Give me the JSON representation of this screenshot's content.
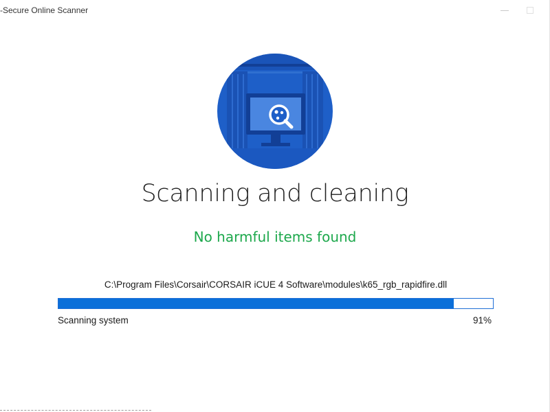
{
  "window": {
    "title": "-Secure Online Scanner"
  },
  "hero": {
    "icon": "scan-monitor-icon",
    "colors": {
      "circle": "#1e5fc8",
      "dark": "#123f96",
      "light": "#4a86e0"
    }
  },
  "main": {
    "heading": "Scanning and cleaning",
    "status": "No harmful items found",
    "status_color": "#1da84c"
  },
  "scan": {
    "current_file": "C:\\Program Files\\Corsair\\CORSAIR iCUE 4 Software\\modules\\k65_rgb_rapidfire.dll",
    "label": "Scanning system",
    "percent_text": "91%",
    "progress": 0.91,
    "bar_color": "#0b6fd9"
  }
}
